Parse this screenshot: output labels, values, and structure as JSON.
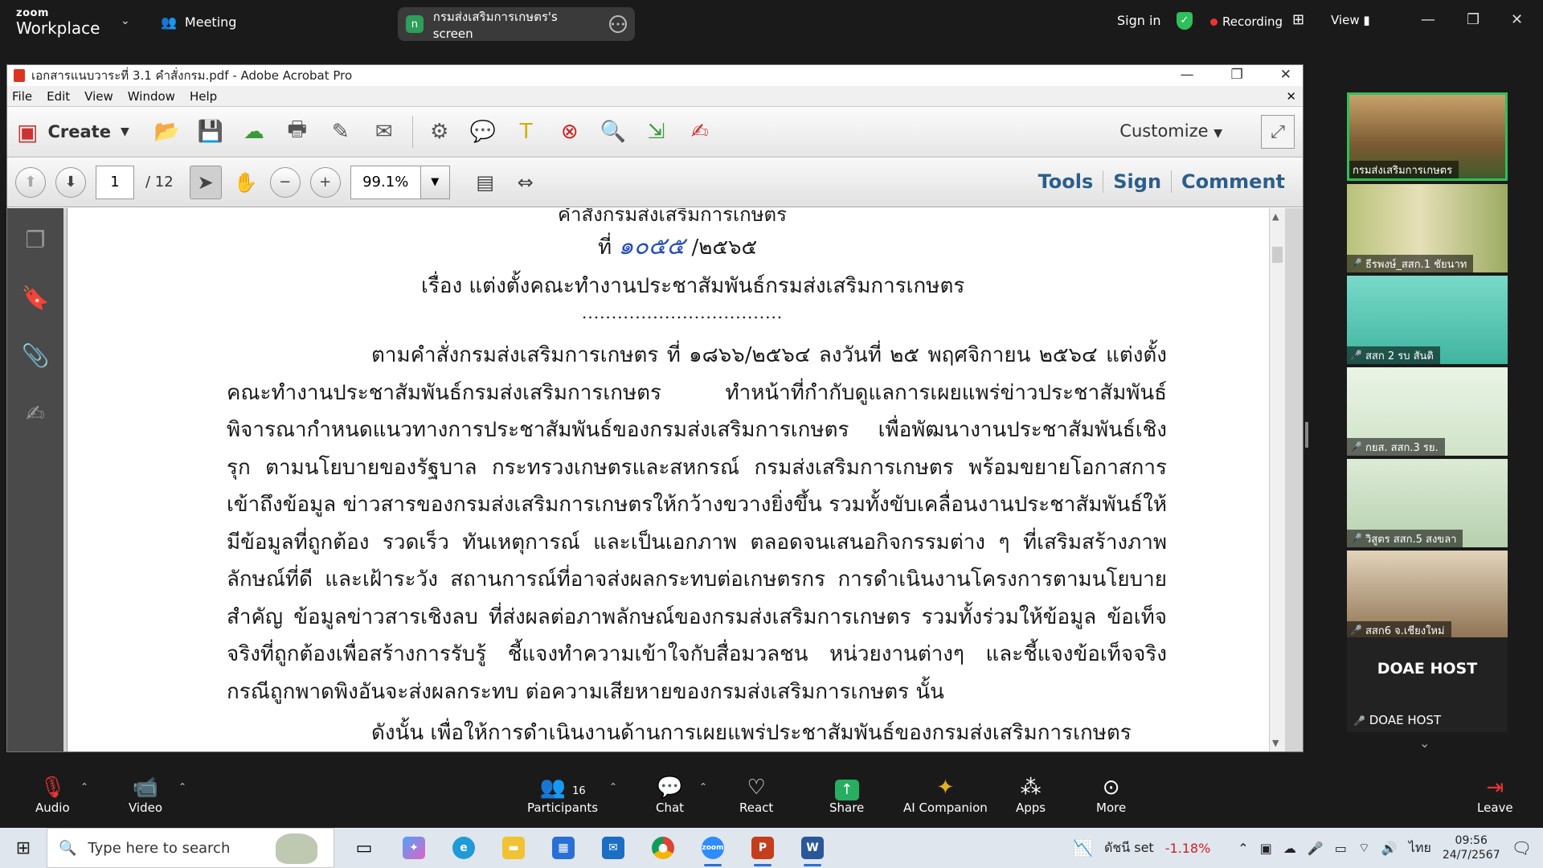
{
  "zoom": {
    "brand_top": "zoom",
    "brand_bottom": "Workplace",
    "meeting_label": "Meeting",
    "share_badge": "n",
    "share_label": "กรมส่งเสริมการเกษตร's screen",
    "sign_in": "Sign in",
    "recording": "Recording",
    "view": "View"
  },
  "acrobat": {
    "window_title": "เอกสารแนบวาระที่ 3.1 คำสั่งกรม.pdf - Adobe Acrobat Pro",
    "menu": [
      "File",
      "Edit",
      "View",
      "Window",
      "Help"
    ],
    "create_label": "Create",
    "customize_label": "Customize",
    "page_current": "1",
    "page_total": "/ 12",
    "zoom_level": "99.1%",
    "tools_label": "Tools",
    "sign_label": "Sign",
    "comment_label": "Comment"
  },
  "document": {
    "header_cut": "คำสั่งกรมส่งเสริมการเกษตร",
    "doc_no_prefix": "ที่",
    "doc_no_hand": "๑๐๕๕",
    "doc_no_year": "/๒๕๖๕",
    "subject": "เรื่อง  แต่งตั้งคณะทำงานประชาสัมพันธ์กรมส่งเสริมการเกษตร",
    "dots": "..................................",
    "body": "ตามคำสั่งกรมส่งเสริมการเกษตร ที่ ๑๘๖๖/๒๕๖๔ ลงวันที่ ๒๕ พฤศจิกายน ๒๕๖๔ แต่งตั้ง คณะทำงานประชาสัมพันธ์กรมส่งเสริมการเกษตร ทำหน้าที่กำกับดูแลการเผยแพร่ข่าวประชาสัมพันธ์ พิจารณากำหนดแนวทางการประชาสัมพันธ์ของกรมส่งเสริมการเกษตร เพื่อพัฒนางานประชาสัมพันธ์เชิงรุก ตามนโยบายของรัฐบาล กระทรวงเกษตรและสหกรณ์ กรมส่งเสริมการเกษตร พร้อมขยายโอกาสการเข้าถึงข้อมูล ข่าวสารของกรมส่งเสริมการเกษตรให้กว้างขวางยิ่งขึ้น รวมทั้งขับเคลื่อนงานประชาสัมพันธ์ให้มีข้อมูลที่ถูกต้อง รวดเร็ว ทันเหตุการณ์ และเป็นเอกภาพ ตลอดจนเสนอกิจกรรมต่าง ๆ ที่เสริมสร้างภาพลักษณ์ที่ดี และเฝ้าระวัง สถานการณ์ที่อาจส่งผลกระทบต่อเกษตรกร การดำเนินงานโครงการตามนโยบายสำคัญ ข้อมูลข่าวสารเชิงลบ ที่ส่งผลต่อภาพลักษณ์ของกรมส่งเสริมการเกษตร รวมทั้งร่วมให้ข้อมูล ข้อเท็จจริงที่ถูกต้องเพื่อสร้างการรับรู้ ชี้แจงทำความเข้าใจกับสื่อมวลชน หน่วยงานต่างๆ และชี้แจงข้อเท็จจริง กรณีถูกพาดพิงอันจะส่งผลกระทบ ต่อความเสียหายของกรมส่งเสริมการเกษตร นั้น",
    "next_line": "ดังนั้น เพื่อให้การดำเนินงานด้านการเผยแพร่ประชาสัมพันธ์ของกรมส่งเสริมการเกษตร"
  },
  "participants": [
    {
      "name": "กรมส่งเสริมการเกษตร",
      "bg": "#8a6a3a",
      "muted": false
    },
    {
      "name": "ธีรพงษ์_สสก.1 ชัยนาท",
      "bg": "#9cab62",
      "muted": true
    },
    {
      "name": "สสก 2 รบ สันติ",
      "bg": "#4fc9b6",
      "muted": true
    },
    {
      "name": "กยส. สสก.3 รย.",
      "bg": "#d9ecd6",
      "muted": true
    },
    {
      "name": "วิสูตร สสก.5 สงขลา",
      "bg": "#cfe3c8",
      "muted": true
    },
    {
      "name": "สสก6 จ.เชียงใหม่",
      "bg": "#a48a66",
      "muted": true
    }
  ],
  "host_tile": {
    "big": "DOAE HOST",
    "label": "DOAE HOST"
  },
  "bottom_bar": {
    "audio": "Audio",
    "video": "Video",
    "participants": "Participants",
    "participants_count": "16",
    "chat": "Chat",
    "react": "React",
    "share": "Share",
    "ai": "AI Companion",
    "apps": "Apps",
    "more": "More",
    "leave": "Leave"
  },
  "taskbar": {
    "search_placeholder": "Type here to search",
    "stock_name": "ดัชนี set",
    "stock_change": "-1.18%",
    "lang": "ไทย",
    "time": "09:56",
    "date": "24/7/2567"
  },
  "colors": {
    "accent_green": "#2fbf5b",
    "record_red": "#e33333",
    "acro_blue": "#2c5e8c"
  }
}
